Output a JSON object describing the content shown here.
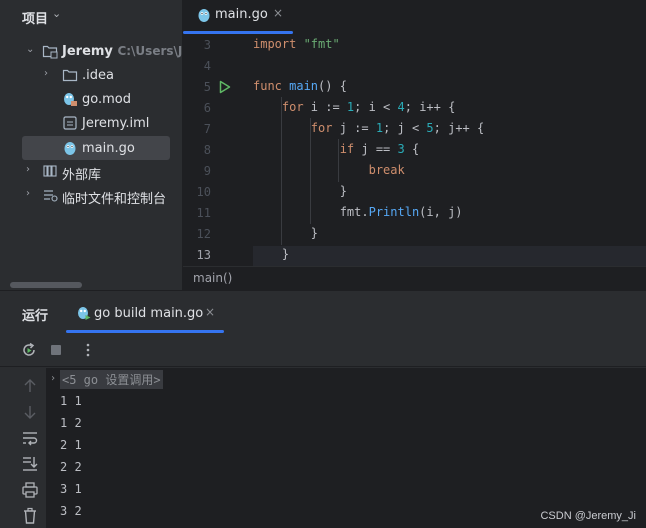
{
  "project": {
    "title": "项目",
    "tree": [
      {
        "label": "Jeremy",
        "hint": "C:\\Users\\Jer",
        "type": "module",
        "expanded": true,
        "depth": 0
      },
      {
        "label": ".idea",
        "type": "folder",
        "expanded": false,
        "depth": 1
      },
      {
        "label": "go.mod",
        "type": "gomod",
        "depth": 1
      },
      {
        "label": "Jeremy.iml",
        "type": "iml",
        "depth": 1
      },
      {
        "label": "main.go",
        "type": "go",
        "depth": 1,
        "selected": true
      },
      {
        "label": "外部库",
        "type": "library",
        "expanded": false,
        "depth": 0
      },
      {
        "label": "临时文件和控制台",
        "type": "scratches",
        "expanded": false,
        "depth": 0
      }
    ]
  },
  "editor": {
    "tab_label": "main.go",
    "tab_close": "×",
    "line_numbers": [
      "3",
      "4",
      "5",
      "6",
      "7",
      "8",
      "9",
      "10",
      "11",
      "12",
      "13"
    ],
    "current_line": "13",
    "code": [
      [
        {
          "t": "import ",
          "c": "kw"
        },
        {
          "t": "\"fmt\"",
          "c": "str"
        }
      ],
      [],
      [
        {
          "t": "func ",
          "c": "kw"
        },
        {
          "t": "main",
          "c": "fn"
        },
        {
          "t": "() {",
          "c": "plain"
        }
      ],
      [
        {
          "t": "    for ",
          "c": "kw"
        },
        {
          "t": "i := ",
          "c": "plain"
        },
        {
          "t": "1",
          "c": "num"
        },
        {
          "t": "; i < ",
          "c": "plain"
        },
        {
          "t": "4",
          "c": "num"
        },
        {
          "t": "; i++ ",
          "c": "plain"
        },
        {
          "t": "{",
          "c": "plain"
        }
      ],
      [
        {
          "t": "        for ",
          "c": "kw"
        },
        {
          "t": "j := ",
          "c": "plain"
        },
        {
          "t": "1",
          "c": "num"
        },
        {
          "t": "; j < ",
          "c": "plain"
        },
        {
          "t": "5",
          "c": "num"
        },
        {
          "t": "; j++ {",
          "c": "plain"
        }
      ],
      [
        {
          "t": "            if ",
          "c": "kw"
        },
        {
          "t": "j == ",
          "c": "plain"
        },
        {
          "t": "3",
          "c": "num"
        },
        {
          "t": " {",
          "c": "plain"
        }
      ],
      [
        {
          "t": "                break",
          "c": "kw"
        }
      ],
      [
        {
          "t": "            }",
          "c": "plain"
        }
      ],
      [
        {
          "t": "            fmt.",
          "c": "pkg"
        },
        {
          "t": "Println",
          "c": "fn"
        },
        {
          "t": "(i, j)",
          "c": "plain"
        }
      ],
      [
        {
          "t": "        }",
          "c": "plain"
        }
      ],
      [
        {
          "t": "    }",
          "c": "plain"
        }
      ]
    ],
    "breadcrumb": "main()"
  },
  "run": {
    "title": "运行",
    "tab_label": "go build main.go",
    "tab_close": "×",
    "console_command": "<5 go 设置调用>",
    "output": [
      "1 1",
      "1 2",
      "2 1",
      "2 2",
      "3 1",
      "3 2"
    ]
  },
  "watermark": "CSDN @Jeremy_Ji",
  "colors": {
    "accent": "#3574f0",
    "keyword": "#cf8e6d",
    "string": "#6aab73",
    "function": "#56a8f5",
    "number": "#2aacb8"
  }
}
